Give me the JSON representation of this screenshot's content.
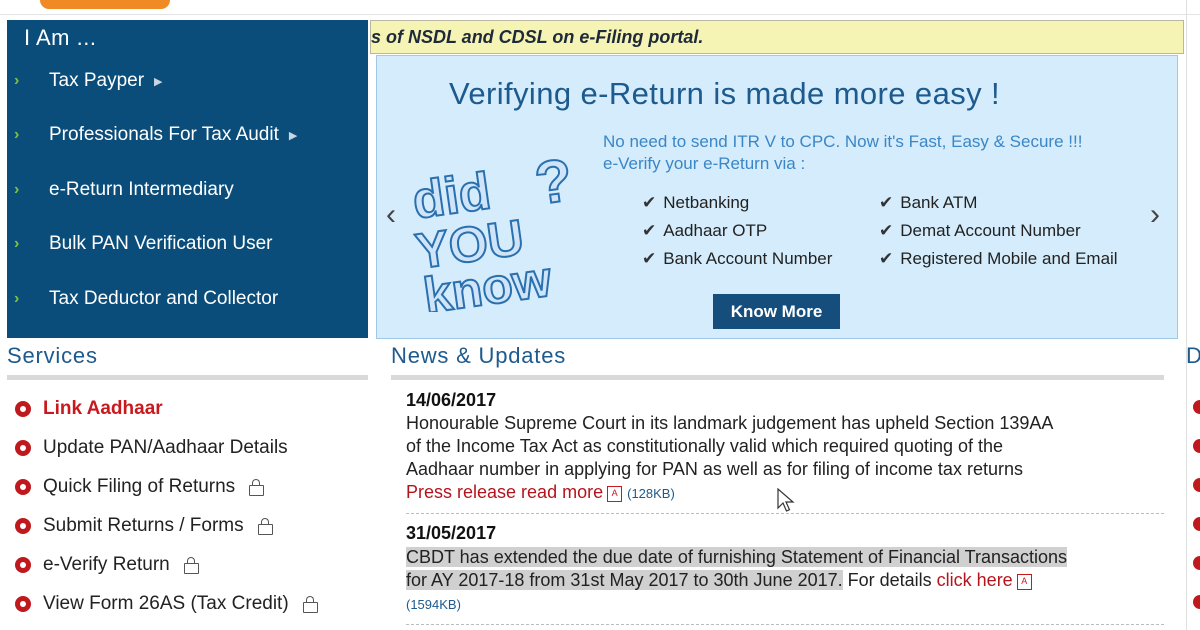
{
  "iam": {
    "title": "I Am ...",
    "items": [
      {
        "label": "Tax Payper"
      },
      {
        "label": "Professionals For Tax Audit"
      },
      {
        "label": "e-Return Intermediary"
      },
      {
        "label": "Bulk PAN Verification User"
      },
      {
        "label": "Tax Deductor and Collector"
      }
    ]
  },
  "ticker": {
    "text": "s of NSDL and CDSL on e-Filing portal."
  },
  "banner": {
    "title": "Verifying e-Return is made more easy !",
    "subtitle1": "No need to send ITR V to CPC. Now it's Fast, Easy & Secure !!!",
    "subtitle2": "e-Verify your e-Return via :",
    "options_left": [
      "Netbanking",
      "Aadhaar OTP",
      "Bank Account Number"
    ],
    "options_right": [
      "Bank ATM",
      "Demat Account Number",
      "Registered Mobile and Email"
    ],
    "button": "Know More",
    "prev_arrow": "‹",
    "next_arrow": "›",
    "image_text": {
      "did": "did",
      "you": "YOU",
      "know": "know",
      "qmark": "?"
    }
  },
  "services": {
    "title": "Services",
    "items": [
      {
        "label": "Link Aadhaar"
      },
      {
        "label": "Update PAN/Aadhaar Details"
      },
      {
        "label": "Quick Filing of Returns"
      },
      {
        "label": "Submit Returns / Forms"
      },
      {
        "label": "e-Verify Return"
      },
      {
        "label": "View Form 26AS (Tax Credit)"
      }
    ]
  },
  "news": {
    "title": "News & Updates",
    "items": [
      {
        "date": "14/06/2017",
        "line1": "Honourable Supreme Court in its landmark judgement has upheld Section 139AA",
        "line2": "of the Income Tax Act as constitutionally valid which required quoting of the",
        "line3": "Aadhaar number in applying for PAN as well as for filing of income tax returns",
        "link": "Press release read more",
        "size": "(128KB)"
      },
      {
        "date": "31/05/2017",
        "line1": "CBDT has extended the due date of furnishing Statement of Financial Transactions",
        "line2": "for AY 2017-18 from 31st May 2017 to 30th June 2017.",
        "line2_tail": " For details ",
        "link": "click here",
        "size": "(1594KB)"
      }
    ]
  },
  "right_column": {
    "title_fragment": "D"
  },
  "colors": {
    "panel": "#0a4d7a",
    "accent": "#1d5a8d",
    "red": "#c0191d",
    "ticker": "#f5f4b4",
    "banner": "#d4ecfb"
  }
}
